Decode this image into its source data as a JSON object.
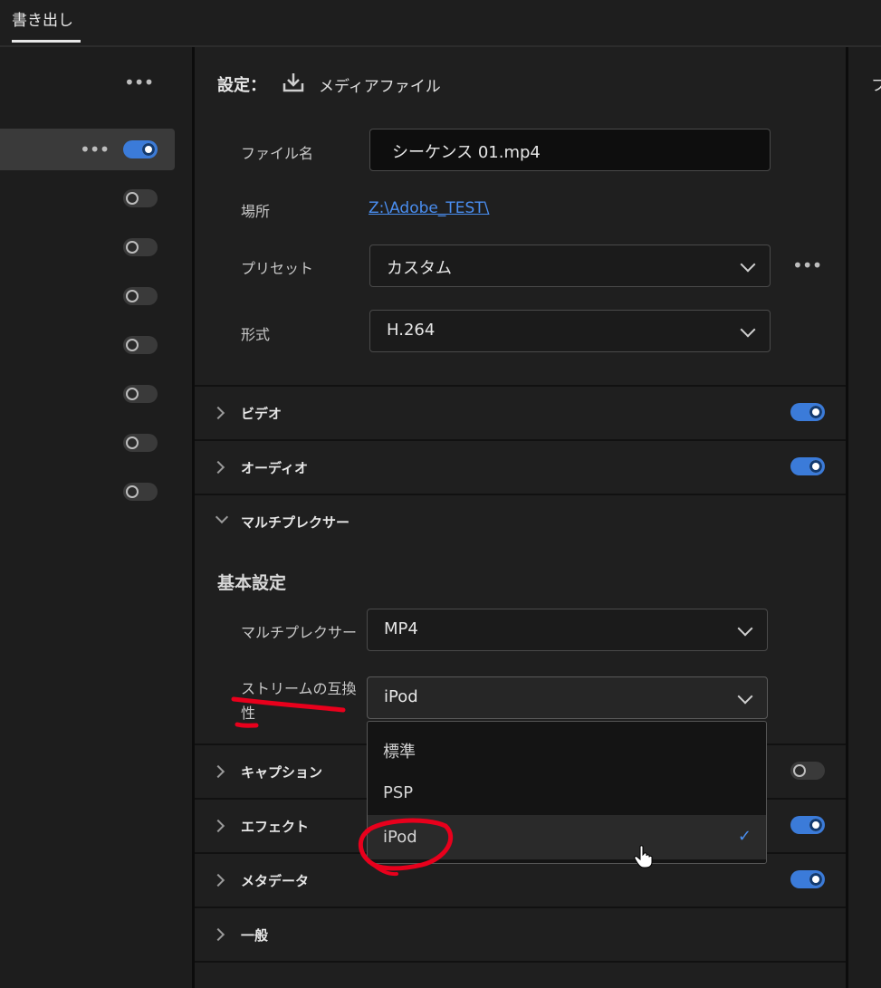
{
  "window": {
    "tab_label": "書き出し"
  },
  "left": {
    "row_toggles": [
      "on",
      "off",
      "off",
      "off",
      "off",
      "off",
      "off",
      "off"
    ]
  },
  "settings": {
    "header_label": "設定：",
    "destination_label": "メディアファイル",
    "filename_label": "ファイル名",
    "filename_value": "シーケンス 01.mp4",
    "location_label": "場所",
    "location_value": "Z:\\Adobe_TEST\\",
    "preset_label": "プリセット",
    "preset_value": "カスタム",
    "format_label": "形式",
    "format_value": "H.264"
  },
  "sections": {
    "video": {
      "label": "ビデオ",
      "enabled": true
    },
    "audio": {
      "label": "オーディオ",
      "enabled": true
    },
    "multiplexer": {
      "label": "マルチプレクサー",
      "expanded": true
    },
    "captions": {
      "label": "キャプション",
      "enabled": false
    },
    "effects": {
      "label": "エフェクト",
      "enabled": true
    },
    "metadata": {
      "label": "メタデータ",
      "enabled": true
    },
    "general": {
      "label": "一般"
    }
  },
  "multiplexer": {
    "basic_heading": "基本設定",
    "mux_label": "マルチプレクサー",
    "mux_value": "MP4",
    "stream_label_line1": "ストリームの互換",
    "stream_label_line2": "性",
    "stream_value": "iPod"
  },
  "dropdown": {
    "options": [
      "標準",
      "PSP",
      "iPod"
    ],
    "selected": "iPod",
    "check_glyph": "✓"
  },
  "right_panel": {
    "title_fragment": "フ"
  },
  "colors": {
    "accent": "#3b7bd9",
    "link": "#4a8ef0",
    "annotation": "#e8001c"
  }
}
